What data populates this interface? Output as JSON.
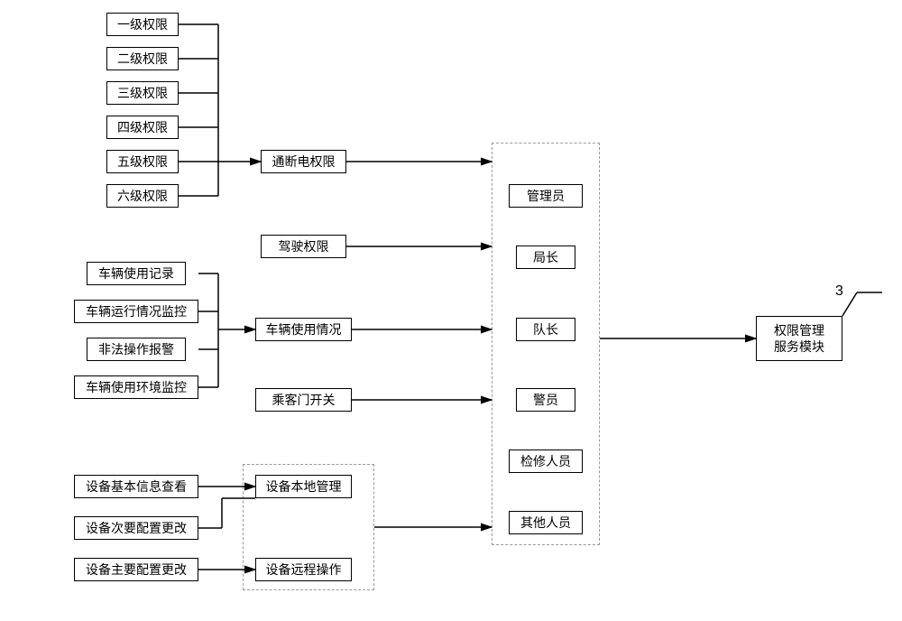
{
  "col1": {
    "level1": "一级权限",
    "level2": "二级权限",
    "level3": "三级权限",
    "level4": "四级权限",
    "level5": "五级权限",
    "level6": "六级权限",
    "vehUseRecord": "车辆使用记录",
    "vehOpMonitor": "车辆运行情况监控",
    "illegalAlarm": "非法操作报警",
    "vehEnvMonitor": "车辆使用环境监控",
    "devBasicInfo": "设备基本信息查看",
    "devMinorConfig": "设备次要配置更改",
    "devMajorConfig": "设备主要配置更改"
  },
  "col2": {
    "powerAuth": "通断电权限",
    "driveAuth": "驾驶权限",
    "vehUseStatus": "车辆使用情况",
    "passengerDoor": "乘客门开关",
    "devLocalMgmt": "设备本地管理",
    "devRemoteOp": "设备远程操作"
  },
  "roles": {
    "admin": "管理员",
    "director": "局长",
    "captain": "队长",
    "officer": "警员",
    "maintainer": "检修人员",
    "other": "其他人员"
  },
  "module": {
    "line1": "权限管理",
    "line2": "服务模块"
  },
  "label3": "3"
}
